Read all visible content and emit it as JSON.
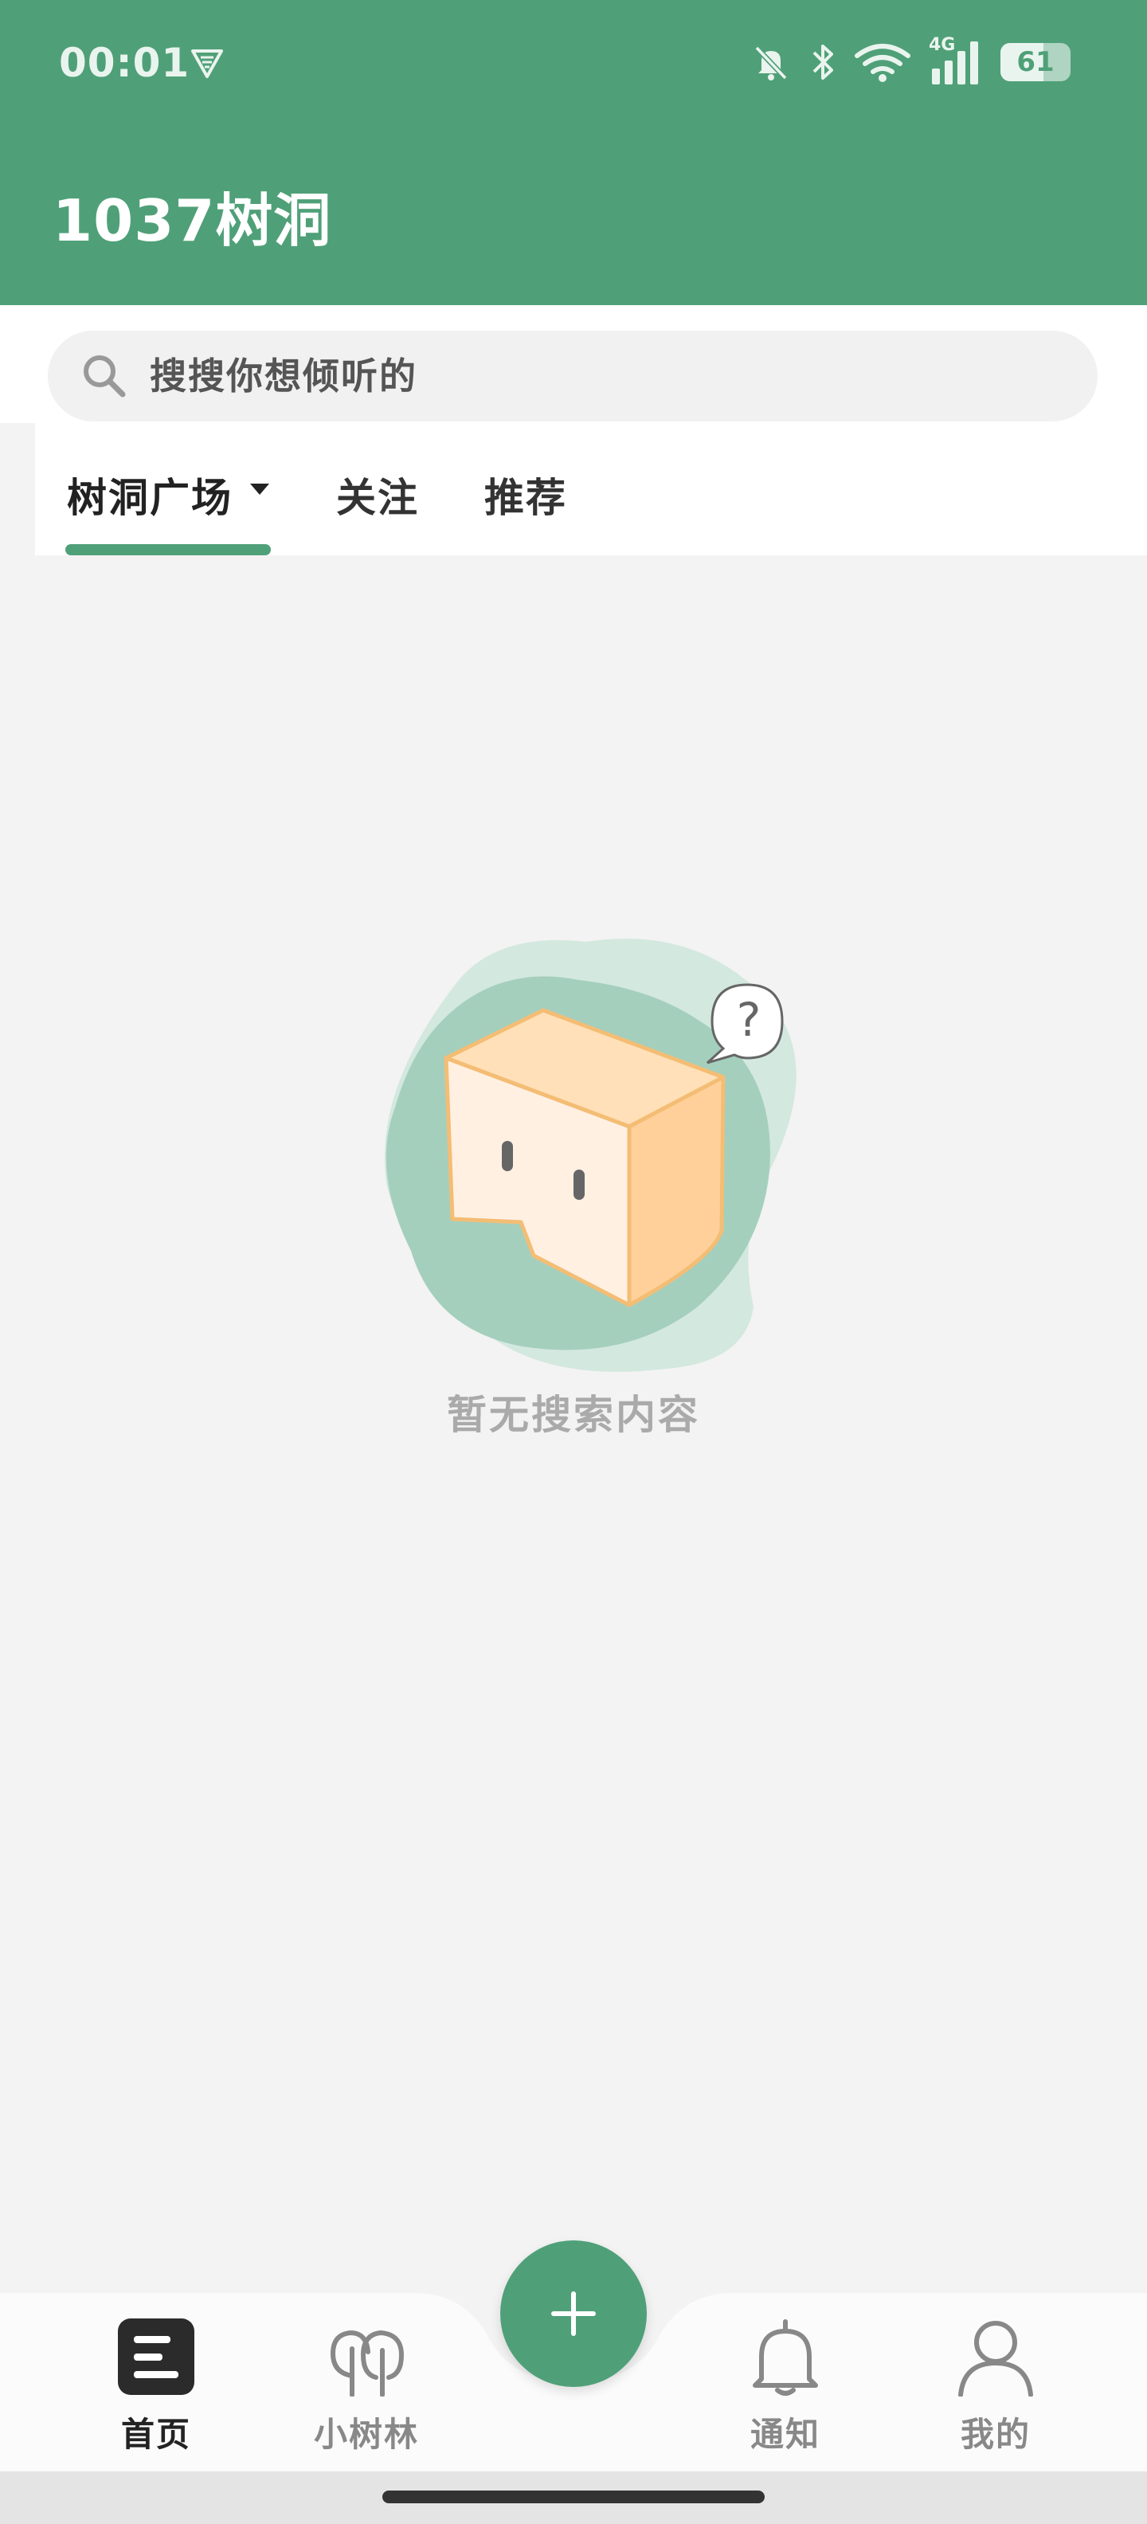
{
  "status_bar": {
    "time": "00:01",
    "network": "4G",
    "battery_percent": "61",
    "battery_level": 0.61,
    "icons": [
      "vpn-shield-icon",
      "bell-muted-icon",
      "bluetooth-icon",
      "wifi-icon",
      "cell-signal-icon",
      "battery-icon"
    ]
  },
  "header": {
    "title": "1037树洞",
    "color": "#4fa078"
  },
  "search": {
    "placeholder": "搜搜你想倾听的",
    "icon": "search-icon"
  },
  "tabs": [
    {
      "label": "树洞广场",
      "selected": true,
      "has_dropdown": true
    },
    {
      "label": "关注",
      "selected": false
    },
    {
      "label": "推荐",
      "selected": false
    }
  ],
  "empty_state": {
    "message": "暂无搜索内容",
    "question_mark": "?",
    "illustration": "confused-box-illustration"
  },
  "fab": {
    "icon": "plus-icon"
  },
  "bottom_nav": [
    {
      "label": "首页",
      "icon": "home-icon",
      "active": true
    },
    {
      "label": "小树林",
      "icon": "trees-icon",
      "active": false
    },
    {
      "label": "通知",
      "icon": "bell-icon",
      "active": false
    },
    {
      "label": "我的",
      "icon": "user-icon",
      "active": false
    }
  ],
  "colors": {
    "accent": "#4fa078",
    "background": "#f3f3f3",
    "muted_text": "#aaaaaa"
  }
}
